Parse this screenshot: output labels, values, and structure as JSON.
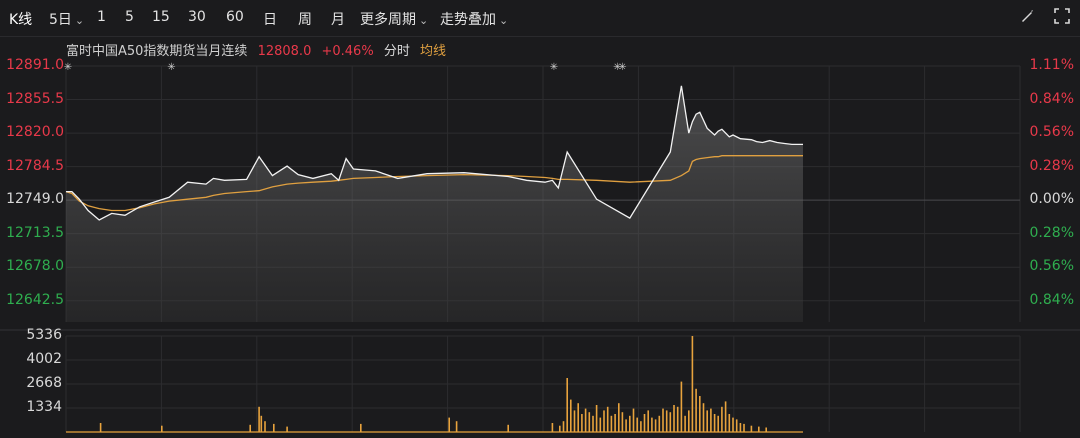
{
  "toolbar": {
    "kline_label": "K线",
    "days_label": "5日",
    "periods": [
      "1",
      "5",
      "15",
      "30",
      "60",
      "日",
      "周",
      "月"
    ],
    "more_label": "更多周期",
    "overlay_label": "走势叠加",
    "brush_icon": "brush-icon",
    "fullscreen_icon": "fullscreen-icon"
  },
  "info": {
    "name": "富时中国A50指数期货当月连续",
    "price": "12808.0",
    "change": "+0.46%",
    "fenshi_label": "分时",
    "avg_label": "均线"
  },
  "colors": {
    "background": "#1b1b1d",
    "grid": "#2c2c2f",
    "price_line": "#f2f2f2",
    "avg_line": "#e0a040",
    "up": "#e8394a",
    "down": "#2fae4f",
    "neutral": "#d9d9d9",
    "volume": "#e8a33d"
  },
  "chart_data": {
    "type": "line",
    "price_axis": {
      "labels": [
        "12891.0",
        "12855.5",
        "12820.0",
        "12784.5",
        "12749.0",
        "12713.5",
        "12678.0",
        "12642.5"
      ],
      "values": [
        12891.0,
        12855.5,
        12820.0,
        12784.5,
        12749.0,
        12713.5,
        12678.0,
        12642.5
      ],
      "pct_labels": [
        "1.11%",
        "0.84%",
        "0.56%",
        "0.28%",
        "0.00%",
        "0.28%",
        "0.56%",
        "0.84%"
      ],
      "base": 12749.0,
      "ylim": [
        12620,
        12891
      ]
    },
    "volume_axis": {
      "labels": [
        "5336",
        "4002",
        "2668",
        "1334"
      ],
      "values": [
        5336,
        4002,
        2668,
        1334
      ],
      "ylim": [
        0,
        5336
      ]
    },
    "x": [
      0,
      0.008,
      0.018,
      0.03,
      0.045,
      0.062,
      0.08,
      0.1,
      0.12,
      0.14,
      0.165,
      0.19,
      0.2,
      0.215,
      0.245,
      0.262,
      0.28,
      0.3,
      0.315,
      0.335,
      0.36,
      0.37,
      0.38,
      0.39,
      0.42,
      0.45,
      0.49,
      0.54,
      0.6,
      0.625,
      0.65,
      0.66,
      0.668,
      0.68,
      0.72,
      0.765,
      0.82,
      0.835,
      0.845,
      0.85,
      0.855,
      0.86,
      0.87,
      0.88,
      0.885,
      0.89,
      0.9,
      0.905,
      0.915,
      0.93,
      0.937,
      0.945,
      0.955,
      0.965,
      0.975,
      0.985,
      0.99,
      1.0
    ],
    "price": [
      12758,
      12758,
      12750,
      12738,
      12728,
      12735,
      12733,
      12742,
      12747,
      12752,
      12768,
      12766,
      12772,
      12770,
      12771,
      12795,
      12775,
      12785,
      12776,
      12772,
      12777,
      12770,
      12793,
      12782,
      12780,
      12772,
      12777,
      12778,
      12774,
      12770,
      12768,
      12770,
      12762,
      12800,
      12750,
      12730,
      12800,
      12870,
      12820,
      12832,
      12840,
      12842,
      12825,
      12818,
      12822,
      12824,
      12816,
      12818,
      12814,
      12813,
      12811,
      12810,
      12812,
      12810,
      12809,
      12808,
      12808,
      12808
    ],
    "avg": [
      12758,
      12756,
      12748,
      12743,
      12740,
      12738,
      12738,
      12741,
      12745,
      12748,
      12750,
      12752,
      12754,
      12756,
      12758,
      12759,
      12763,
      12766,
      12767,
      12768,
      12769,
      12770,
      12771,
      12772,
      12773,
      12774,
      12775,
      12776,
      12775,
      12774,
      12773,
      12772,
      12771,
      12771,
      12770,
      12768,
      12770,
      12775,
      12780,
      12790,
      12792,
      12793,
      12794,
      12795,
      12795,
      12796,
      12796,
      12796,
      12796,
      12796,
      12796,
      12796,
      12796,
      12796,
      12796,
      12796,
      12796,
      12796
    ],
    "volume_x": [
      0.047,
      0.13,
      0.25,
      0.262,
      0.265,
      0.27,
      0.282,
      0.3,
      0.4,
      0.52,
      0.53,
      0.6,
      0.66,
      0.67,
      0.675,
      0.68,
      0.685,
      0.69,
      0.695,
      0.7,
      0.705,
      0.71,
      0.715,
      0.72,
      0.725,
      0.73,
      0.735,
      0.74,
      0.745,
      0.75,
      0.755,
      0.76,
      0.765,
      0.77,
      0.775,
      0.78,
      0.785,
      0.79,
      0.795,
      0.8,
      0.805,
      0.81,
      0.815,
      0.82,
      0.825,
      0.83,
      0.835,
      0.84,
      0.845,
      0.85,
      0.855,
      0.86,
      0.865,
      0.87,
      0.875,
      0.88,
      0.885,
      0.89,
      0.895,
      0.9,
      0.905,
      0.91,
      0.915,
      0.92,
      0.93,
      0.94,
      0.95
    ],
    "volume": [
      500,
      350,
      400,
      1400,
      900,
      600,
      450,
      300,
      450,
      800,
      600,
      400,
      500,
      350,
      600,
      3000,
      1800,
      1200,
      1600,
      1000,
      1300,
      1100,
      900,
      1500,
      800,
      1200,
      1400,
      900,
      1000,
      1600,
      1100,
      700,
      900,
      1300,
      800,
      600,
      1000,
      1200,
      800,
      700,
      900,
      1300,
      1200,
      1100,
      1500,
      1400,
      2800,
      900,
      1200,
      5336,
      2400,
      2000,
      1600,
      1200,
      1300,
      1000,
      900,
      1400,
      1700,
      1000,
      800,
      700,
      500,
      450,
      350,
      300,
      250
    ],
    "event_markers_x": [
      0.0,
      0.143,
      0.662,
      0.748,
      0.755
    ]
  }
}
